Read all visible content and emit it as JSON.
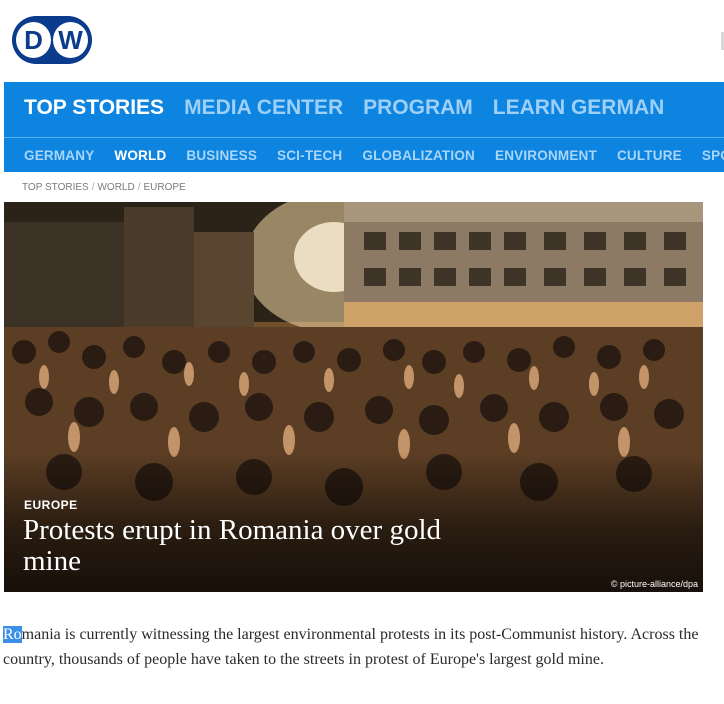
{
  "logo": {
    "letter1": "D",
    "letter2": "W"
  },
  "nav": {
    "main": [
      "TOP STORIES",
      "MEDIA CENTER",
      "PROGRAM",
      "LEARN GERMAN"
    ],
    "sub": [
      "GERMANY",
      "WORLD",
      "BUSINESS",
      "SCI-TECH",
      "GLOBALIZATION",
      "ENVIRONMENT",
      "CULTURE",
      "SPO"
    ]
  },
  "breadcrumb": [
    "TOP STORIES",
    "WORLD",
    "EUROPE"
  ],
  "hero": {
    "category": "EUROPE",
    "headline": "Protests erupt in Romania over gold mine",
    "credit": "© picture-alliance/dpa"
  },
  "article": {
    "highlighted": "Ro",
    "rest": "mania is currently witnessing the largest environmental protests in its post-Communist history. Across the country, thousands of people have taken to the streets in protest of Europe's largest gold mine."
  },
  "colors": {
    "nav_blue": "#0e84e1",
    "logo_blue": "#0a3b8c",
    "highlight": "#3b8fe6"
  }
}
